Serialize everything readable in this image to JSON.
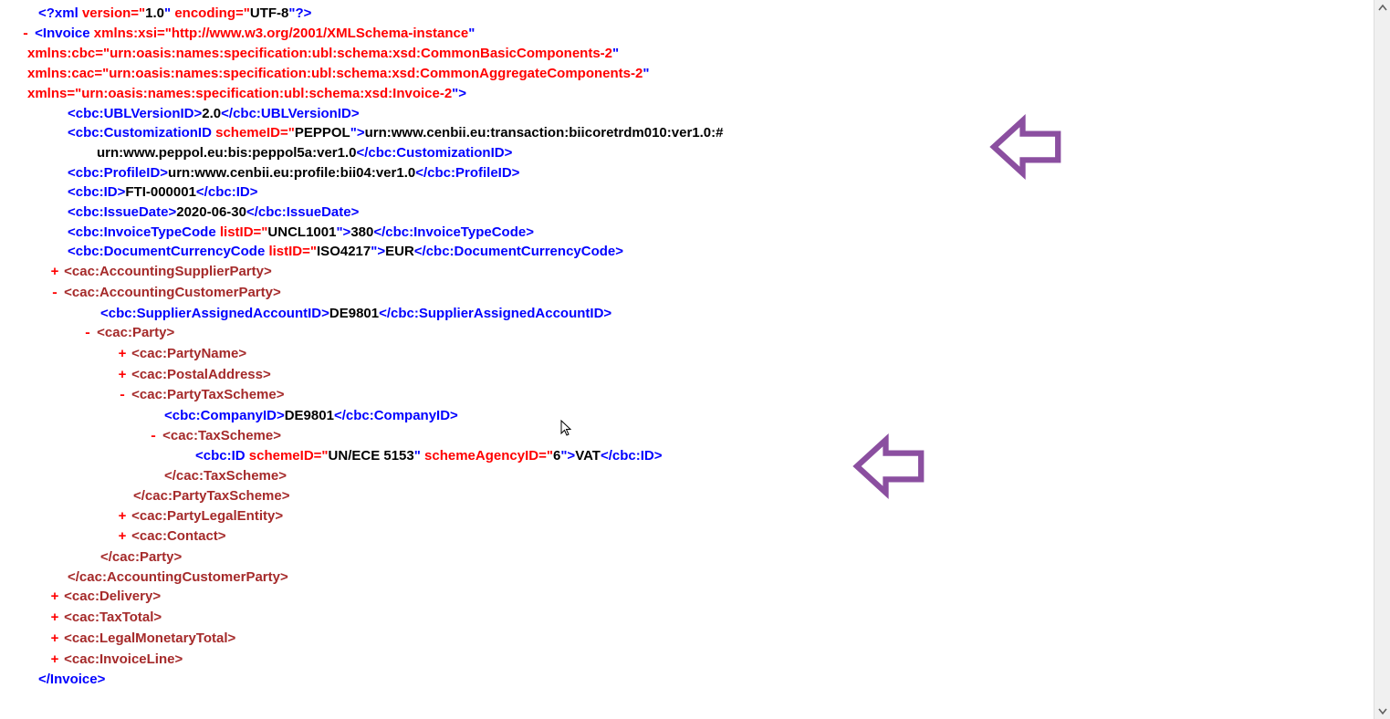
{
  "xml_declaration": {
    "open": "<?xml ",
    "attr1_name": "version=\"",
    "attr1_val": "1.0",
    "mid": "\" ",
    "attr2_name": "encoding=\"",
    "attr2_val": "UTF-8",
    "close": "\"?>"
  },
  "invoice_open": {
    "tag": "<Invoice ",
    "xsi": "xmlns:xsi=\"",
    "xsi_val": "http://www.w3.org/2001/XMLSchema-instance",
    "xsi_end": "\"",
    "cbc": "xmlns:cbc=\"",
    "cbc_val": "urn:oasis:names:specification:ubl:schema:xsd:CommonBasicComponents-2",
    "cbc_end": "\"",
    "cac": "xmlns:cac=\"",
    "cac_val": "urn:oasis:names:specification:ubl:schema:xsd:CommonAggregateComponents-2",
    "cac_end": "\"",
    "xmlns": "xmlns=\"",
    "xmlns_val": "urn:oasis:names:specification:ubl:schema:xsd:Invoice-2",
    "xmlns_end": "\">"
  },
  "ublversion": {
    "open": "<cbc:UBLVersionID>",
    "val": "2.0",
    "close": "</cbc:UBLVersionID>"
  },
  "customization": {
    "open": "<cbc:CustomizationID ",
    "attr": "schemeID=\"",
    "attrval": "PEPPOL",
    "attrend": "\">",
    "val1": "urn:www.cenbii.eu:transaction:biicoretrdm010:ver1.0:#",
    "val2": "urn:www.peppol.eu:bis:peppol5a:ver1.0",
    "close": "</cbc:CustomizationID>"
  },
  "profile": {
    "open": "<cbc:ProfileID>",
    "val": "urn:www.cenbii.eu:profile:bii04:ver1.0",
    "close": "</cbc:ProfileID>"
  },
  "cbcid": {
    "open": "<cbc:ID>",
    "val": "FTI-000001",
    "close": "</cbc:ID>"
  },
  "issuedate": {
    "open": "<cbc:IssueDate>",
    "val": "2020-06-30",
    "close": "</cbc:IssueDate>"
  },
  "invoicetype": {
    "open": "<cbc:InvoiceTypeCode ",
    "attr": "listID=\"",
    "attrval": "UNCL1001",
    "attrend": "\">",
    "val": "380",
    "close": "</cbc:InvoiceTypeCode>"
  },
  "currency": {
    "open": "<cbc:DocumentCurrencyCode ",
    "attr": "listID=\"",
    "attrval": "ISO4217",
    "attrend": "\">",
    "val": "EUR",
    "close": "</cbc:DocumentCurrencyCode>"
  },
  "supplier_party": "<cac:AccountingSupplierParty>",
  "customer_party_open": "<cac:AccountingCustomerParty>",
  "customer_party_close": "</cac:AccountingCustomerParty>",
  "supplier_assigned": {
    "open": "<cbc:SupplierAssignedAccountID>",
    "val": "DE9801",
    "close": "</cbc:SupplierAssignedAccountID>"
  },
  "party_open": "<cac:Party>",
  "party_close": "</cac:Party>",
  "party_name": "<cac:PartyName>",
  "postal_address": "<cac:PostalAddress>",
  "party_tax_open": "<cac:PartyTaxScheme>",
  "party_tax_close": "</cac:PartyTaxScheme>",
  "company_id": {
    "open": "<cbc:CompanyID>",
    "val": "DE9801",
    "close": "</cbc:CompanyID>"
  },
  "tax_scheme_open": "<cac:TaxScheme>",
  "tax_scheme_close": "</cac:TaxScheme>",
  "taxid": {
    "open": "<cbc:ID ",
    "a1": "schemeID=\"",
    "a1v": "UN/ECE 5153",
    "a1e": "\" ",
    "a2": "schemeAgencyID=\"",
    "a2v": "6",
    "a2e": "\">",
    "val": "VAT",
    "close": "</cbc:ID>"
  },
  "party_legal": "<cac:PartyLegalEntity>",
  "contact": "<cac:Contact>",
  "delivery": "<cac:Delivery>",
  "tax_total": "<cac:TaxTotal>",
  "legal_monetary": "<cac:LegalMonetaryTotal>",
  "invoice_line": "<cac:InvoiceLine>",
  "invoice_close": "</Invoice>",
  "toggles": {
    "plus": "+",
    "minus": "-"
  },
  "arrow_color": "#8b4fa0"
}
